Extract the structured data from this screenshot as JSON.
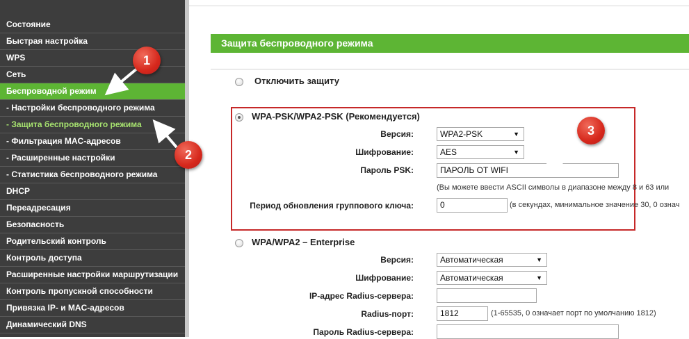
{
  "sidebar": {
    "items": [
      {
        "label": "Состояние"
      },
      {
        "label": "Быстрая настройка"
      },
      {
        "label": "WPS"
      },
      {
        "label": "Сеть"
      },
      {
        "label": "Беспроводной режим"
      },
      {
        "label": "- Настройки беспроводного режима"
      },
      {
        "label": "- Защита беспроводного режима"
      },
      {
        "label": "- Фильтрация MAC-адресов"
      },
      {
        "label": "- Расширенные настройки"
      },
      {
        "label": "- Статистика беспроводного режима"
      },
      {
        "label": "DHCP"
      },
      {
        "label": "Переадресация"
      },
      {
        "label": "Безопасность"
      },
      {
        "label": "Родительский контроль"
      },
      {
        "label": "Контроль доступа"
      },
      {
        "label": "Расширенные настройки маршрутизации"
      },
      {
        "label": "Контроль пропускной способности"
      },
      {
        "label": "Привязка IP- и MAC-адресов"
      },
      {
        "label": "Динамический DNS"
      }
    ]
  },
  "header": {
    "title": "Защита беспроводного режима"
  },
  "disable": {
    "label": "Отключить защиту"
  },
  "wpa_psk": {
    "title": "WPA-PSK/WPA2-PSK (Рекомендуется)",
    "version_label": "Версия:",
    "version_value": "WPA2-PSK",
    "encryption_label": "Шифрование:",
    "encryption_value": "AES",
    "password_label": "Пароль PSK:",
    "password_value": "ПАРОЛЬ ОТ WIFI",
    "password_note": "(Вы можете ввести ASCII символы в диапазоне между 8 и 63 или",
    "group_key_label": "Период обновления группового ключа:",
    "group_key_value": "0",
    "group_key_note": "(в секундах, минимальное значение 30, 0 означ"
  },
  "enterprise": {
    "title": "WPA/WPA2 – Enterprise",
    "version_label": "Версия:",
    "version_value": "Автоматическая",
    "encryption_label": "Шифрование:",
    "encryption_value": "Автоматическая",
    "radius_ip_label": "IP-адрес Radius-сервера:",
    "radius_ip_value": "",
    "radius_port_label": "Radius-порт:",
    "radius_port_value": "1812",
    "radius_port_note": "(1-65535, 0 означает порт по умолчанию 1812)",
    "radius_password_label": "Пароль Radius-сервера:",
    "radius_password_value": ""
  },
  "annotations": [
    "1",
    "2",
    "3"
  ],
  "colors": {
    "accent_green": "#5db534",
    "annotation_red": "#d6281c",
    "sidebar_bg": "#3d3d3d",
    "current_item_text": "#a7e36f"
  },
  "icons": {
    "dropdown": "chevron-down-icon",
    "radio": "radio-button"
  }
}
